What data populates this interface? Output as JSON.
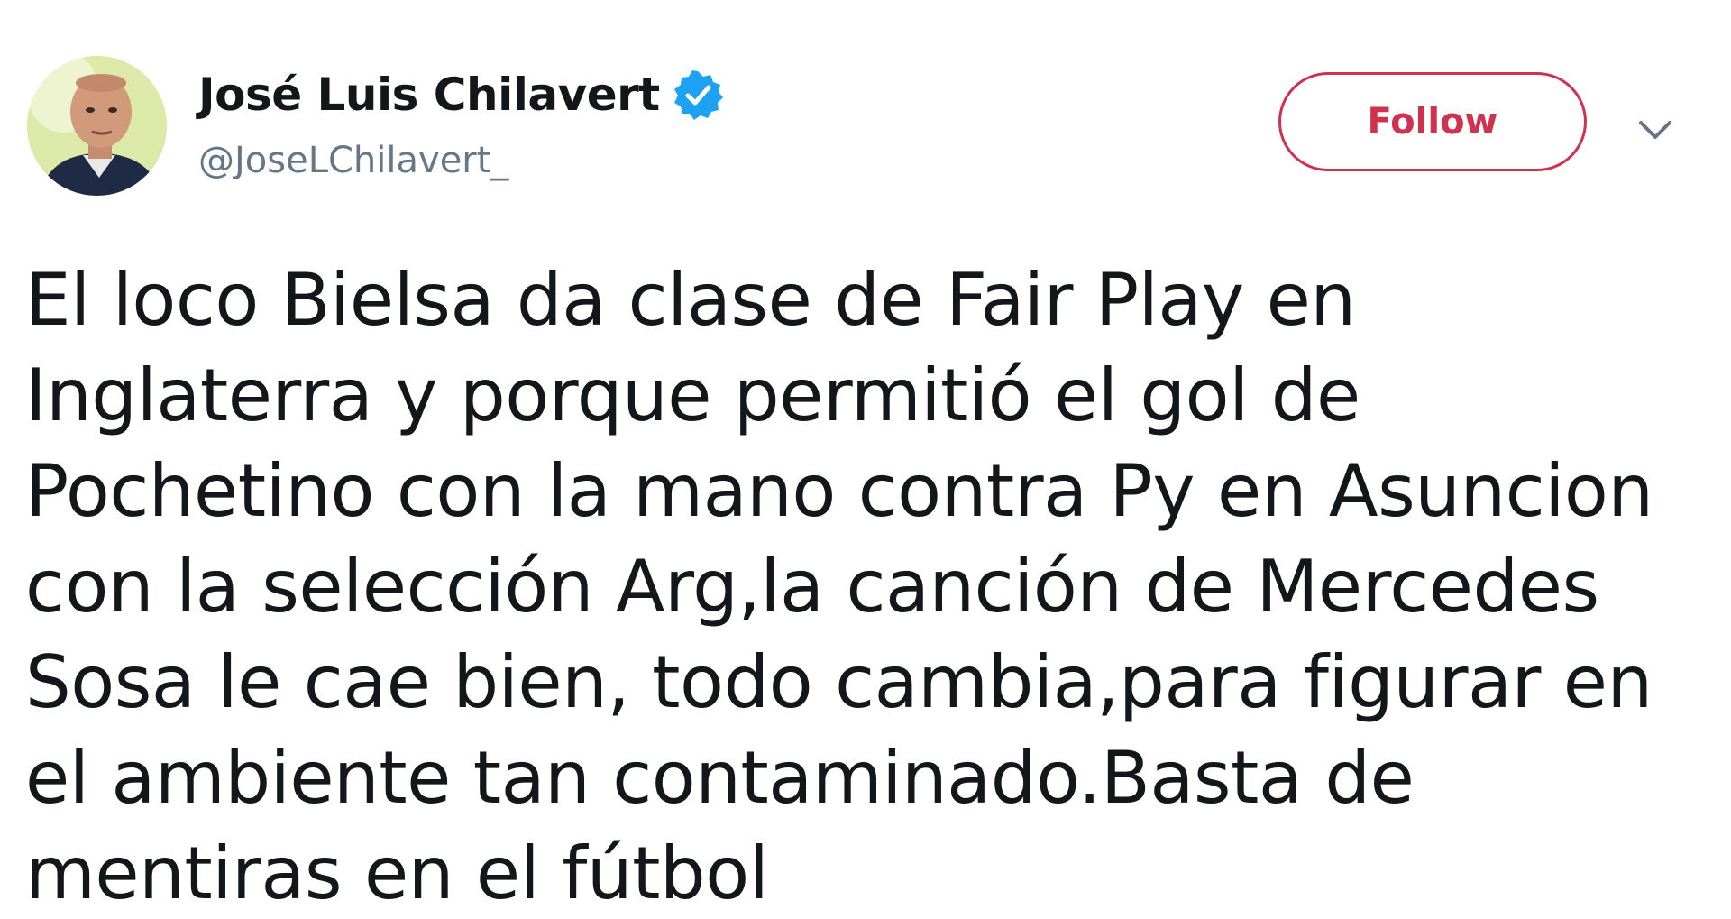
{
  "author": {
    "display_name": "José Luis Chilavert",
    "handle": "@JoseLChilavert_",
    "verified": true,
    "verified_icon": "verified-badge-icon",
    "avatar_icon": "avatar"
  },
  "actions": {
    "follow_label": "Follow",
    "menu_icon": "chevron-down-icon"
  },
  "tweet": {
    "lines": [
      "El loco Bielsa da clase de Fair Play en",
      "Inglaterra y porque permitió el gol de",
      "Pochetino con la mano contra Py en Asuncion",
      "con la selección Arg,la canción de Mercedes",
      "Sosa le cae bien, todo cambia,para figurar en",
      "el ambiente tan contaminado.Basta de",
      "mentiras en el fútbol"
    ]
  },
  "colors": {
    "follow_accent": "#d0314e",
    "verified_blue": "#1da1f2",
    "handle_gray": "#657786",
    "text": "#14171a"
  }
}
